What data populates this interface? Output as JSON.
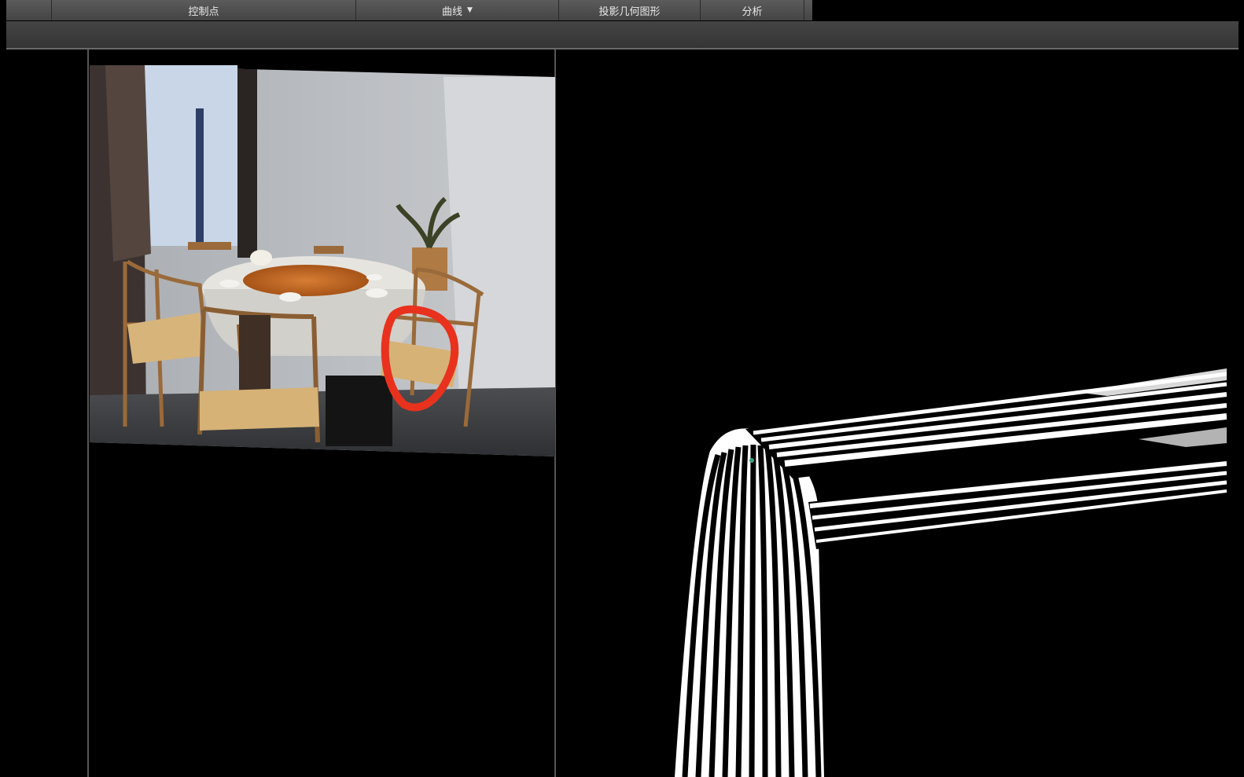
{
  "tabs": [
    {
      "label": "控制点",
      "has_dropdown": false
    },
    {
      "label": "曲线",
      "has_dropdown": true
    },
    {
      "label": "投影几何图形",
      "has_dropdown": false
    },
    {
      "label": "分析",
      "has_dropdown": false
    }
  ],
  "icons": {
    "dropdown": "caret-down-icon"
  },
  "colors": {
    "toolbar": "#3d3d3d",
    "viewport_bg": "#000000",
    "annotation": "#e8321e"
  }
}
